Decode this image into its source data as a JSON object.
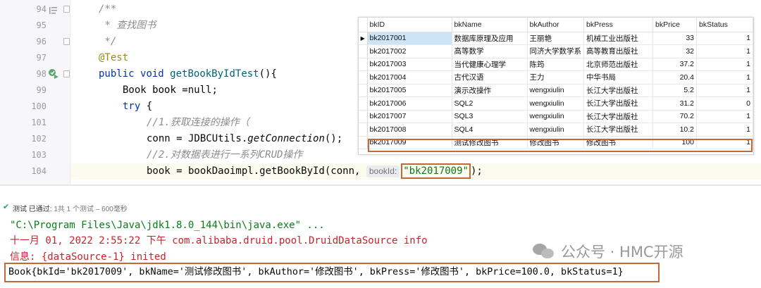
{
  "editor": {
    "lines": [
      {
        "num": "94",
        "text": "/**"
      },
      {
        "num": "95",
        "text": " * 查找图书"
      },
      {
        "num": "96",
        "text": " */"
      },
      {
        "num": "97",
        "text": "@Test"
      },
      {
        "num": "98",
        "kw1": "public",
        "kw2": "void",
        "fn": "getBookByIdTest",
        "rest": "(){"
      },
      {
        "num": "99",
        "type": "Book",
        "var": "book",
        "rest": " =null;"
      },
      {
        "num": "100",
        "kw": "try",
        "rest": " {"
      },
      {
        "num": "101",
        "text": "//1.获取连接的操作（"
      },
      {
        "num": "102",
        "var": "conn",
        "mid": " = JDBCUtils.",
        "fn": "getConnection",
        "rest": "();"
      },
      {
        "num": "103",
        "text": "//2.对数据表进行一系列CRUD操作"
      },
      {
        "num": "104",
        "var": "book",
        "mid": " = bookDaoimpl.getBookById(conn, ",
        "hint": "bookId:",
        "str": "\"bk2017009\"",
        "rest": ");"
      }
    ]
  },
  "table": {
    "columns": [
      "bkID",
      "bkName",
      "bkAuthor",
      "bkPress",
      "bkPrice",
      "bkStatus"
    ],
    "rows": [
      [
        "bk2017001",
        "数据库原理及应用",
        "王丽艳",
        "机械工业出版社",
        "33",
        "1"
      ],
      [
        "bk2017002",
        "高等数学",
        "同济大学数学系",
        "高等教育出版社",
        "32",
        "1"
      ],
      [
        "bk2017003",
        "当代健康心理学",
        "陈筠",
        "北京师范出版社",
        "37.2",
        "1"
      ],
      [
        "bk2017004",
        "古代汉语",
        "王力",
        "中华书局",
        "20.4",
        "1"
      ],
      [
        "bk2017005",
        "演示改操作",
        "wengxiulin",
        "长江大学出版社",
        "5.2",
        "1"
      ],
      [
        "bk2017006",
        "SQL2",
        "wengxiulin",
        "长江大学出版社",
        "31.2",
        "0"
      ],
      [
        "bk2017007",
        "SQL3",
        "wengxiulin",
        "长江大学出版社",
        "70.2",
        "1"
      ],
      [
        "bk2017008",
        "SQL4",
        "wengxiulin",
        "长江大学出版社",
        "10.2",
        "1"
      ],
      [
        "bk2017009",
        "测试修改图书",
        "修改图书",
        "修改图书",
        "100",
        "1"
      ]
    ]
  },
  "run": {
    "status": "测试 已通过:",
    "detail": " 1共 1 个测试 – 600毫秒"
  },
  "console": {
    "line1": "\"C:\\Program Files\\Java\\jdk1.8.0_144\\bin\\java.exe\" ...",
    "line2": "十一月 01, 2022 2:55:22 下午 com.alibaba.druid.pool.DruidDataSource info",
    "line3": "信息: {dataSource-1} inited",
    "line4": "Book{bkId='bk2017009', bkName='测试修改图书', bkAuthor='修改图书', bkPress='修改图书', bkPrice=100.0, bkStatus=1}"
  },
  "watermark": "公众号 · HMC开源",
  "colors": {
    "highlight_box": "#c06a3c",
    "keyword": "#0033b3",
    "string": "#067d17",
    "error_text": "#c7222d",
    "pass_green": "#2e9e4d"
  }
}
